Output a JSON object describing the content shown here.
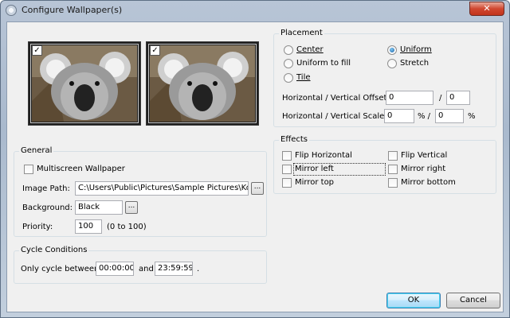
{
  "window": {
    "title": "Configure Wallpaper(s)",
    "close_glyph": "✕"
  },
  "preview": {
    "thumbnails": [
      {
        "name": "koala-1",
        "checked": true,
        "check_glyph": "✓"
      },
      {
        "name": "koala-2",
        "checked": true,
        "check_glyph": "✓"
      }
    ]
  },
  "general": {
    "title": "General",
    "multiscreen_label": "Multiscreen Wallpaper",
    "image_path_label": "Image Path:",
    "image_path_value": "C:\\Users\\Public\\Pictures\\Sample Pictures\\Koal",
    "browse_label": "...",
    "background_label": "Background:",
    "background_value": "Black",
    "background_button": "...",
    "priority_label": "Priority:",
    "priority_value": "100",
    "priority_hint": "(0 to 100)"
  },
  "cycle": {
    "title": "Cycle Conditions",
    "only_cycle_label": "Only cycle between",
    "start_value": "00:00:00",
    "and_label": "and",
    "end_value": "23:59:59",
    "end_dot": "."
  },
  "placement": {
    "title": "Placement",
    "options": [
      {
        "label": "Center",
        "selected": false
      },
      {
        "label": "Uniform",
        "selected": true
      },
      {
        "label": "Uniform to fill",
        "selected": false
      },
      {
        "label": "Stretch",
        "selected": false
      },
      {
        "label": "Tile",
        "selected": false
      }
    ],
    "offset_label": "Horizontal / Vertical Offset:",
    "offset_h": "0",
    "offset_sep": "/",
    "offset_v": "0",
    "scale_label": "Horizontal / Vertical Scale:",
    "scale_h": "0",
    "scale_sep": "%  /",
    "scale_v": "0",
    "scale_unit": "%"
  },
  "effects": {
    "title": "Effects",
    "items": [
      {
        "label": "Flip Horizontal",
        "checked": false
      },
      {
        "label": "Flip Vertical",
        "checked": false
      },
      {
        "label": "Mirror left",
        "checked": false
      },
      {
        "label": "Mirror right",
        "checked": false
      },
      {
        "label": "Mirror top",
        "checked": false
      },
      {
        "label": "Mirror bottom",
        "checked": false
      }
    ]
  },
  "buttons": {
    "ok": "OK",
    "cancel": "Cancel"
  }
}
